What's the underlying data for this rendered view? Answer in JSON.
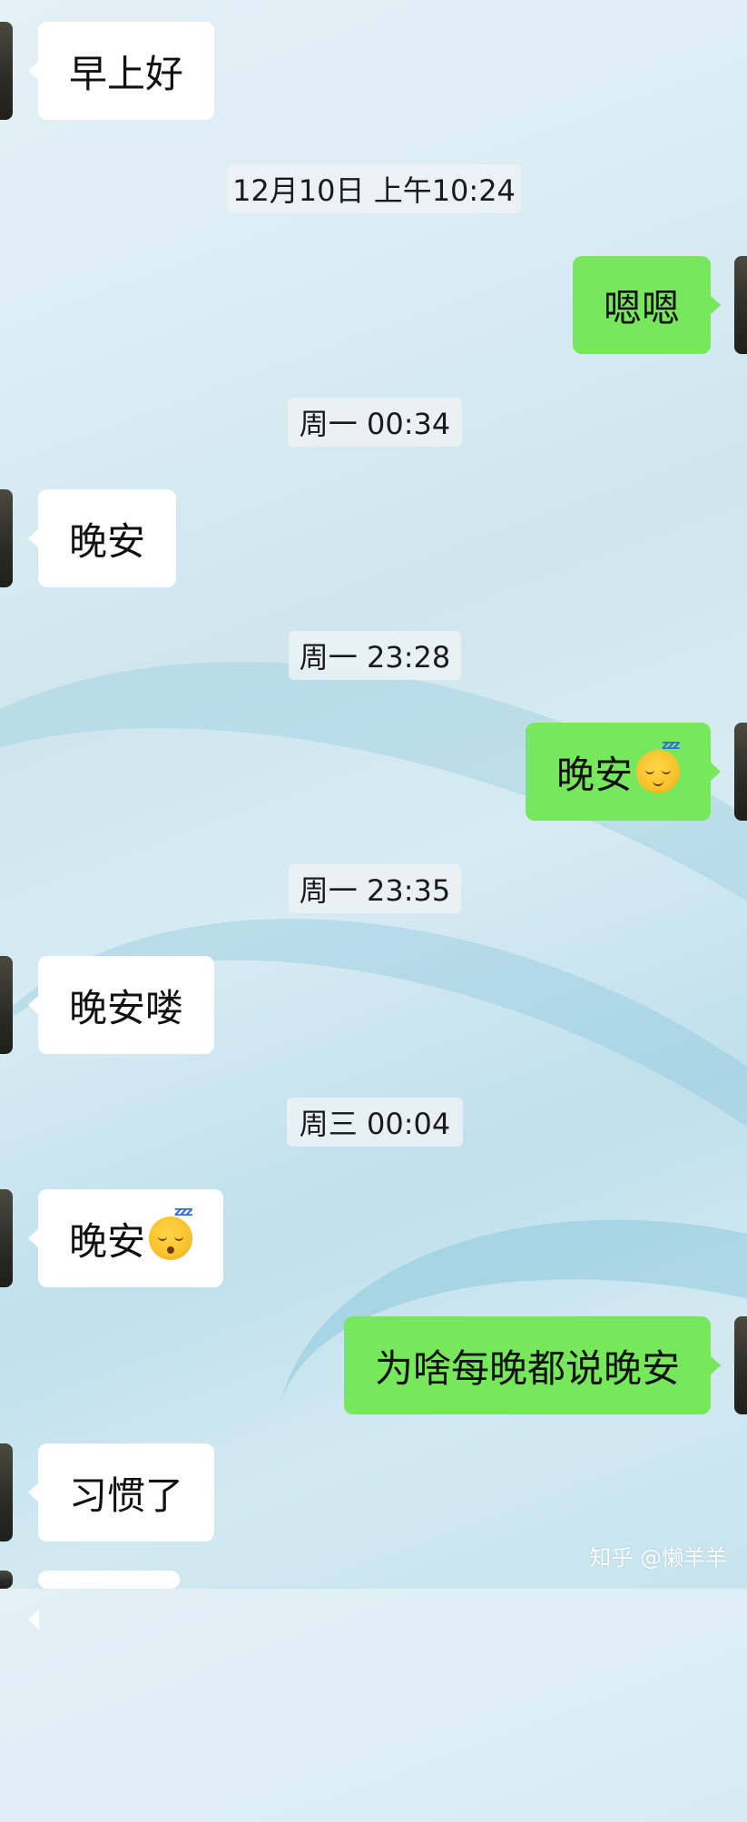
{
  "messages": [
    {
      "side": "left",
      "text": "早上好"
    },
    {
      "side": "right",
      "text": "嗯嗯"
    },
    {
      "side": "left",
      "text": "晚安"
    },
    {
      "side": "right",
      "text": "晚安",
      "emoji": "sleeping-face-emoji"
    },
    {
      "side": "left",
      "text": "晚安喽"
    },
    {
      "side": "left",
      "text": "晚安",
      "emoji": "sleepy-face-emoji"
    },
    {
      "side": "right",
      "text": "为啥每晚都说晚安"
    },
    {
      "side": "left",
      "text": "习惯了"
    }
  ],
  "timestamps": [
    "12月10日 上午10:24",
    "周一 00:34",
    "周一 23:28",
    "周一 23:35",
    "周三 00:04"
  ],
  "watermark": "知乎 @懒羊羊",
  "colors": {
    "sent_bubble": "#77e85c",
    "received_bubble": "#ffffff"
  }
}
